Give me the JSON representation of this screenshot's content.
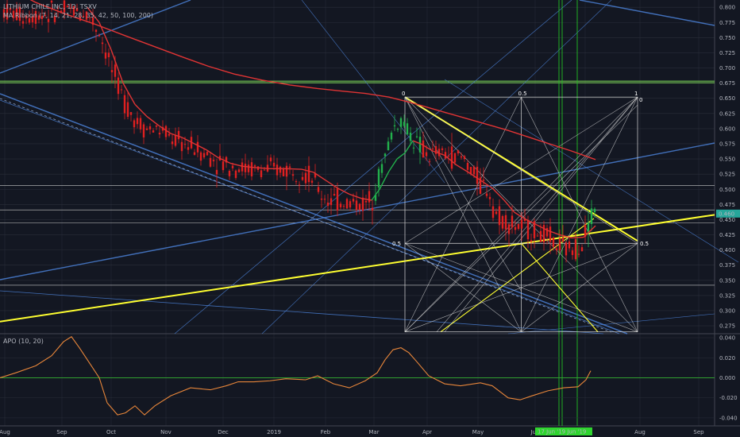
{
  "header": {
    "symbol_line": "LITHIUM CHILE INC, 1D, TSXV",
    "ribbon_label": "MA Ribbon (7, 14, 21, 28, 35, 42, 50, 100, 200)"
  },
  "colors": {
    "background": "#131722",
    "grid": "#2a2e39",
    "candle_down": "#e02020",
    "candle_up": "#22b14c",
    "ma_red": "#e03434",
    "trend_blue": "#4a7fd4",
    "trend_yellow": "#ffff30",
    "fib_lines": "#d8d8d8",
    "green_level": "#7ed957",
    "apo_line": "#e8863a",
    "apo_zero": "#30a030",
    "price_badge": "#26a69a"
  },
  "chart_data": [
    {
      "type": "candlestick",
      "name": "price",
      "y_ticks": [
        "0.800",
        "0.775",
        "0.750",
        "0.725",
        "0.700",
        "0.675",
        "0.650",
        "0.625",
        "0.600",
        "0.575",
        "0.550",
        "0.525",
        "0.500",
        "0.475",
        "0.450",
        "0.425",
        "0.400",
        "0.375",
        "0.350",
        "0.325",
        "0.300",
        "0.275"
      ],
      "ylim": [
        0.262,
        0.812
      ],
      "x_ticks": [
        "Aug",
        "Sep",
        "Oct",
        "Nov",
        "Dec",
        "2019",
        "Feb",
        "Mar",
        "Apr",
        "May",
        "Jun",
        "Jul",
        "Aug",
        "Sep"
      ],
      "last_price": "0.460",
      "date_badge": "17 Jun '19  Jun '19",
      "ma_line": {
        "name": "MA 200",
        "points": [
          [
            0,
            0.84
          ],
          [
            20,
            0.825
          ],
          [
            45,
            0.808
          ],
          [
            80,
            0.79
          ],
          [
            120,
            0.772
          ],
          [
            160,
            0.752
          ],
          [
            195,
            0.735
          ],
          [
            230,
            0.718
          ],
          [
            262,
            0.703
          ],
          [
            295,
            0.69
          ],
          [
            330,
            0.68
          ],
          [
            365,
            0.672
          ],
          [
            400,
            0.666
          ],
          [
            430,
            0.662
          ],
          [
            460,
            0.658
          ],
          [
            490,
            0.652
          ],
          [
            520,
            0.642
          ],
          [
            560,
            0.627
          ],
          [
            600,
            0.612
          ],
          [
            640,
            0.597
          ],
          [
            680,
            0.58
          ],
          [
            720,
            0.563
          ],
          [
            750,
            0.549
          ]
        ]
      },
      "short_ma": {
        "name": "MA fast",
        "points": [
          [
            110,
            0.8
          ],
          [
            125,
            0.775
          ],
          [
            140,
            0.73
          ],
          [
            155,
            0.675
          ],
          [
            170,
            0.64
          ],
          [
            185,
            0.62
          ],
          [
            200,
            0.605
          ],
          [
            215,
            0.592
          ],
          [
            230,
            0.585
          ],
          [
            245,
            0.575
          ],
          [
            260,
            0.565
          ],
          [
            275,
            0.552
          ],
          [
            290,
            0.543
          ],
          [
            305,
            0.538
          ],
          [
            320,
            0.536
          ],
          [
            340,
            0.534
          ],
          [
            360,
            0.534
          ],
          [
            380,
            0.533
          ],
          [
            395,
            0.528
          ],
          [
            410,
            0.515
          ],
          [
            425,
            0.502
          ],
          [
            440,
            0.492
          ],
          [
            455,
            0.485
          ],
          [
            468,
            0.482
          ],
          [
            478,
            0.5
          ],
          [
            490,
            0.53
          ],
          [
            500,
            0.55
          ],
          [
            510,
            0.56
          ],
          [
            520,
            0.58
          ],
          [
            530,
            0.575
          ],
          [
            545,
            0.563
          ],
          [
            560,
            0.556
          ],
          [
            575,
            0.54
          ],
          [
            590,
            0.528
          ],
          [
            605,
            0.515
          ],
          [
            620,
            0.502
          ],
          [
            635,
            0.482
          ],
          [
            648,
            0.462
          ],
          [
            660,
            0.452
          ],
          [
            675,
            0.442
          ],
          [
            690,
            0.432
          ],
          [
            705,
            0.425
          ],
          [
            720,
            0.42
          ],
          [
            735,
            0.421
          ],
          [
            750,
            0.44
          ]
        ],
        "green_from_x": 468,
        "green_to_x": 525
      },
      "candle_range": {
        "x_start": 5,
        "x_end": 752,
        "step": 4
      }
    },
    {
      "type": "line",
      "name": "APO (10, 20)",
      "y_ticks": [
        "0.040",
        "0.020",
        "0.000",
        "-0.020",
        "-0.040"
      ],
      "ylim": [
        -0.048,
        0.044
      ],
      "points": [
        [
          0,
          0.0
        ],
        [
          20,
          0.005
        ],
        [
          45,
          0.012
        ],
        [
          65,
          0.022
        ],
        [
          80,
          0.036
        ],
        [
          90,
          0.041
        ],
        [
          100,
          0.03
        ],
        [
          115,
          0.012
        ],
        [
          125,
          0.0
        ],
        [
          135,
          -0.025
        ],
        [
          148,
          -0.037
        ],
        [
          158,
          -0.035
        ],
        [
          170,
          -0.028
        ],
        [
          182,
          -0.037
        ],
        [
          195,
          -0.028
        ],
        [
          215,
          -0.018
        ],
        [
          240,
          -0.01
        ],
        [
          265,
          -0.012
        ],
        [
          285,
          -0.008
        ],
        [
          300,
          -0.004
        ],
        [
          320,
          -0.004
        ],
        [
          340,
          -0.003
        ],
        [
          360,
          -0.001
        ],
        [
          385,
          -0.002
        ],
        [
          400,
          0.002
        ],
        [
          420,
          -0.006
        ],
        [
          440,
          -0.01
        ],
        [
          460,
          -0.003
        ],
        [
          475,
          0.005
        ],
        [
          485,
          0.018
        ],
        [
          495,
          0.028
        ],
        [
          505,
          0.03
        ],
        [
          515,
          0.025
        ],
        [
          525,
          0.016
        ],
        [
          540,
          0.002
        ],
        [
          560,
          -0.006
        ],
        [
          580,
          -0.008
        ],
        [
          605,
          -0.005
        ],
        [
          620,
          -0.008
        ],
        [
          640,
          -0.02
        ],
        [
          655,
          -0.022
        ],
        [
          670,
          -0.018
        ],
        [
          690,
          -0.013
        ],
        [
          710,
          -0.01
        ],
        [
          728,
          -0.009
        ],
        [
          738,
          -0.002
        ],
        [
          744,
          0.007
        ]
      ]
    }
  ]
}
